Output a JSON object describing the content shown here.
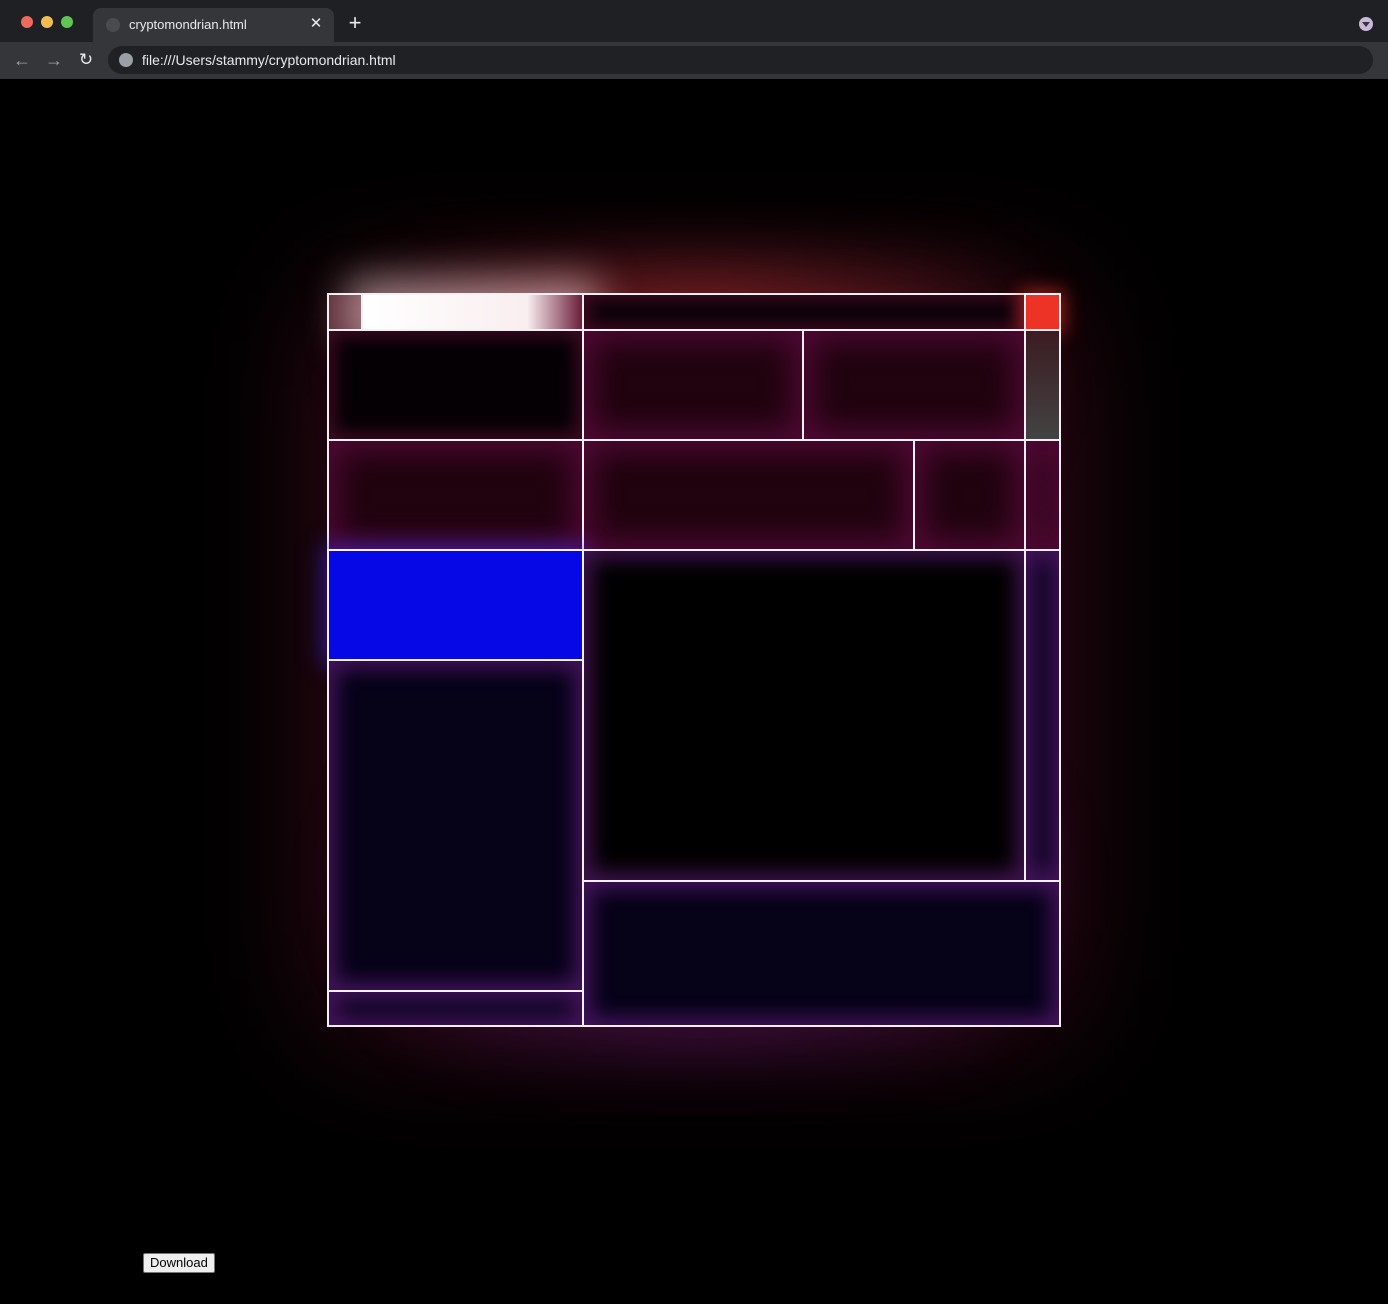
{
  "browser": {
    "tab_title": "cryptomondrian.html",
    "tab_close_glyph": "✕",
    "new_tab_glyph": "+",
    "address": "file:///Users/stammy/cryptomondrian.html",
    "nav_back_glyph": "←",
    "nav_forward_glyph": "→",
    "reload_glyph": "↻",
    "icons": {
      "favicon": "globe-icon",
      "omnibox": "globe-icon",
      "tab_menu": "chevron-down-icon"
    }
  },
  "artwork": {
    "title": "",
    "colors": {
      "line": "#f2f0f4",
      "red": "#ec3326",
      "blue": "#0708e6",
      "white": "#ffffff",
      "gray": "#434343",
      "maroon": "#20030f",
      "navy": "#060218",
      "black": "#010001",
      "glow_red": "#dc3c3c",
      "glow_purple": "#781ea0"
    }
  },
  "download_label": "Download"
}
